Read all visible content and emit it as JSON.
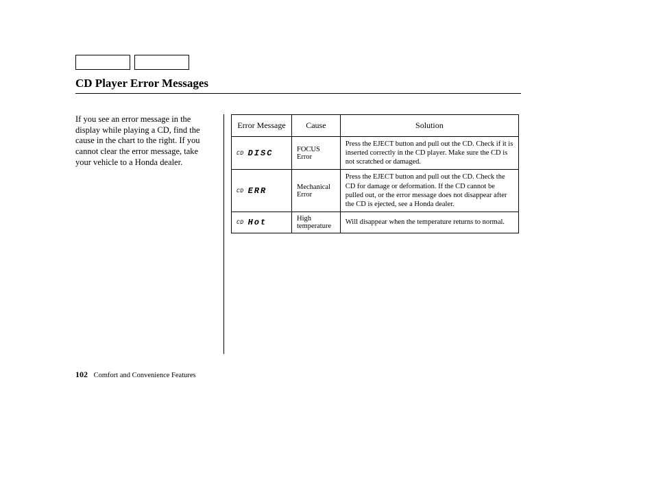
{
  "title": "CD Player Error Messages",
  "intro": "If you see an error message in the display while playing a CD, find the cause in the chart to the right. If you cannot clear the error message, take your vehicle to a Honda dealer.",
  "table": {
    "headers": {
      "msg": "Error Message",
      "cause": "Cause",
      "solution": "Solution"
    },
    "rows": [
      {
        "prefix": "CD",
        "msg": "DISC",
        "cause": "FOCUS Error",
        "solution": "Press the EJECT button and pull out the CD. Check if it is inserted correctly in the CD player. Make sure the CD is not scratched or damaged."
      },
      {
        "prefix": "CD",
        "msg": "ERR",
        "cause": "Mechanical Error",
        "solution": "Press the EJECT button and pull out the CD. Check the CD for damage or deformation. If the CD cannot be pulled out, or the error message does not disappear after the CD is ejected, see a Honda dealer."
      },
      {
        "prefix": "CD",
        "msg": "Hot",
        "cause": "High temperature",
        "solution": "Will disappear when the temperature returns to normal."
      }
    ]
  },
  "footer": {
    "page_number": "102",
    "section": "Comfort and Convenience Features"
  }
}
